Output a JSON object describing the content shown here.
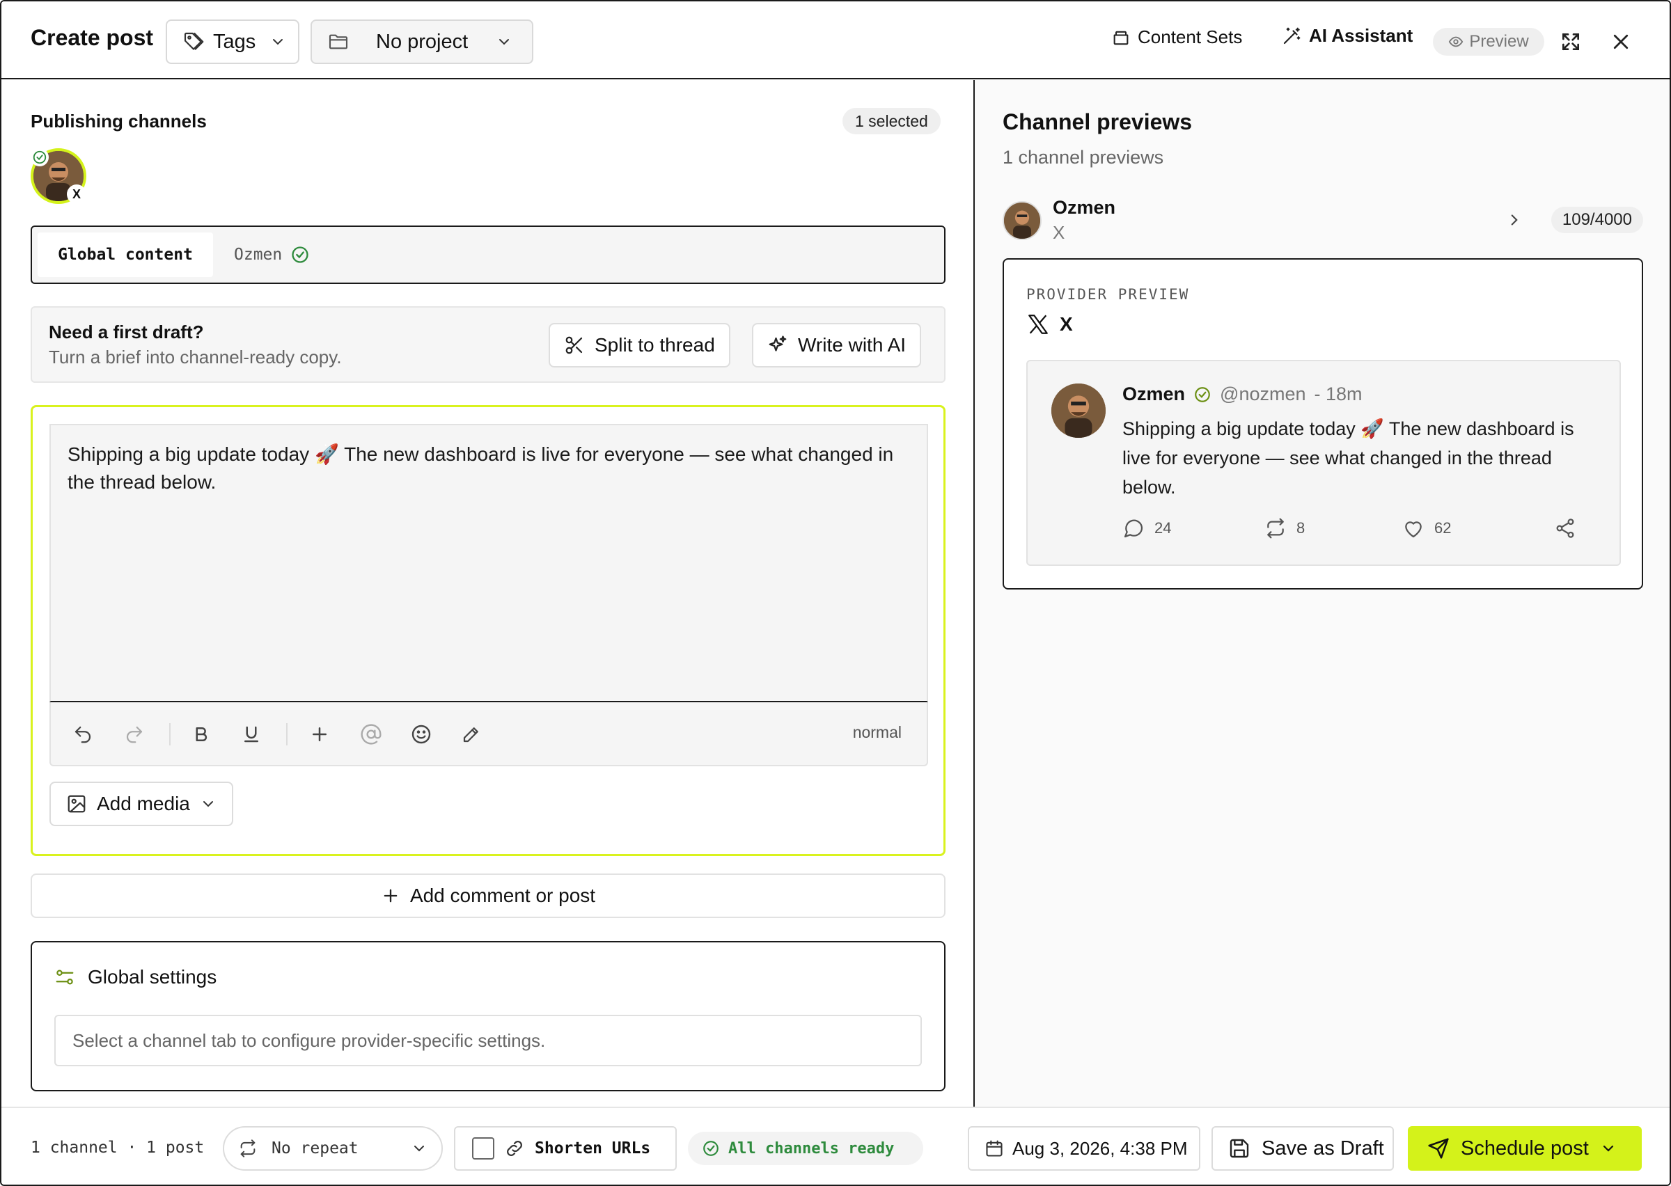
{
  "header": {
    "title": "Create post",
    "tags_label": "Tags",
    "project_label": "No project",
    "content_sets_label": "Content Sets",
    "ai_assistant_label": "AI Assistant",
    "preview_label": "Preview"
  },
  "channels": {
    "section_label": "Publishing channels",
    "selected_badge": "1 selected",
    "avatar_platform": "X"
  },
  "tabs": {
    "global_label": "Global content",
    "channel_label": "Ozmen"
  },
  "draft": {
    "title": "Need a first draft?",
    "subtitle": "Turn a brief into channel-ready copy.",
    "split_label": "Split to thread",
    "write_label": "Write with AI"
  },
  "editor": {
    "text": "Shipping a big update today 🚀  The new dashboard is live for everyone — see what changed in the thread below.",
    "mode": "normal",
    "add_media_label": "Add media"
  },
  "add_comment_label": "Add comment or post",
  "settings": {
    "title": "Global settings",
    "placeholder": "Select a channel tab to configure provider-specific settings."
  },
  "previews": {
    "title": "Channel previews",
    "subtitle": "1 channel previews",
    "channel_name": "Ozmen",
    "channel_platform": "X",
    "char_count": "109/4000",
    "provider_label": "PROVIDER PREVIEW",
    "provider_name": "X",
    "tweet": {
      "name": "Ozmen",
      "handle": "@nozmen",
      "time": "- 18m",
      "text": "Shipping a big update today 🚀  The new dashboard is live for everyone — see what changed in the thread below.",
      "replies": "24",
      "reposts": "8",
      "likes": "62"
    }
  },
  "footer": {
    "count": "1 channel · 1 post",
    "repeat_label": "No repeat",
    "shorten_label": "Shorten URLs",
    "ready_label": "All channels ready",
    "date_label": "Aug 3, 2026, 4:38 PM",
    "save_label": "Save as Draft",
    "schedule_label": "Schedule post"
  },
  "colors": {
    "accent": "#d4f21a",
    "success": "#2e8b3d",
    "border_dark": "#1a1a1a"
  }
}
